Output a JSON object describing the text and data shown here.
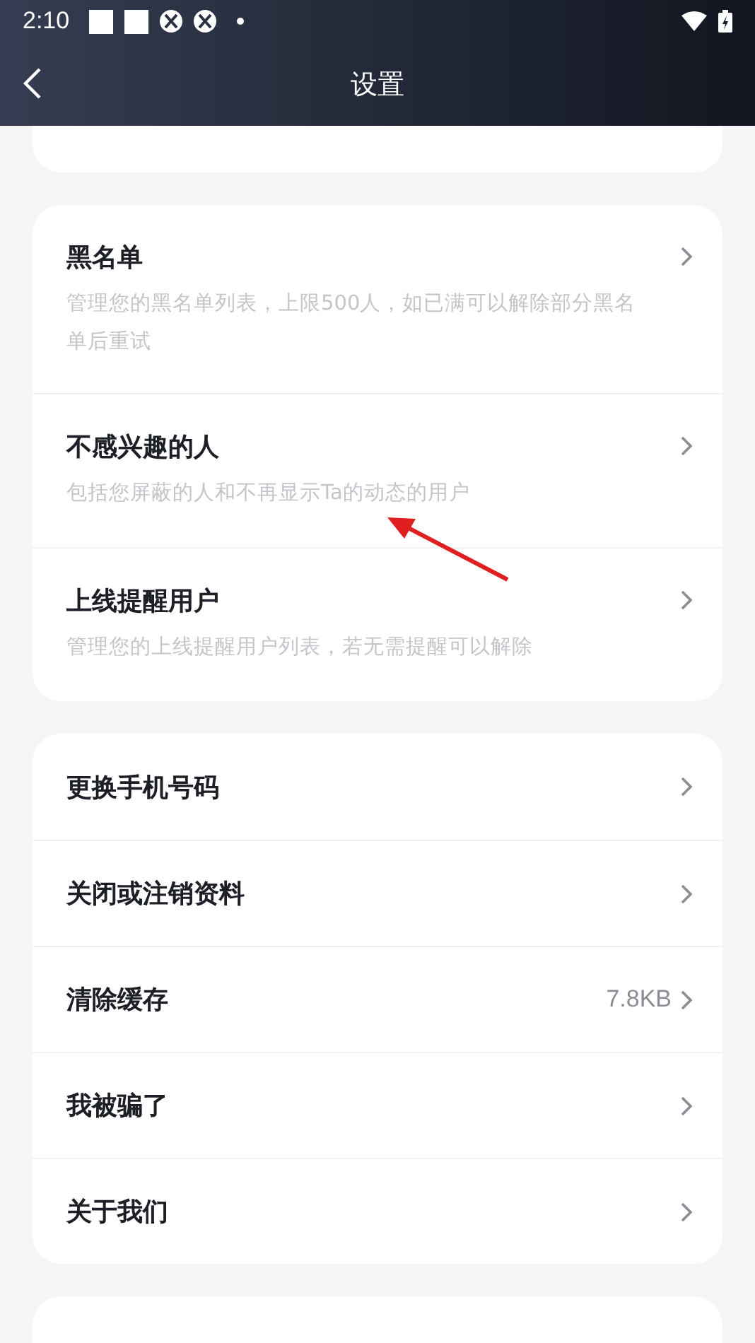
{
  "status_bar": {
    "time": "2:10"
  },
  "header": {
    "title": "设置"
  },
  "groups": [
    {
      "items": [
        {
          "title": "黑名单",
          "description": "管理您的黑名单列表，上限500人，如已满可以解除部分黑名单后重试"
        },
        {
          "title": "不感兴趣的人",
          "description": "包括您屏蔽的人和不再显示Ta的动态的用户"
        },
        {
          "title": "上线提醒用户",
          "description": "管理您的上线提醒用户列表，若无需提醒可以解除"
        }
      ]
    },
    {
      "items": [
        {
          "title": "更换手机号码"
        },
        {
          "title": "关闭或注销资料"
        },
        {
          "title": "清除缓存",
          "value": "7.8KB"
        },
        {
          "title": "我被骗了"
        },
        {
          "title": "关于我们"
        }
      ]
    }
  ]
}
